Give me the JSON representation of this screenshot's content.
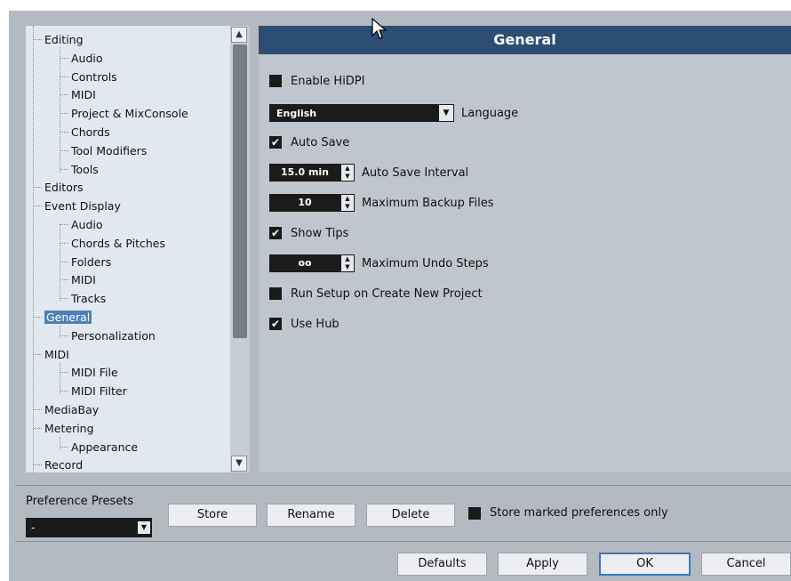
{
  "tree": {
    "items": [
      {
        "label": "Editing",
        "level": 0
      },
      {
        "label": "Audio",
        "level": 1
      },
      {
        "label": "Controls",
        "level": 1
      },
      {
        "label": "MIDI",
        "level": 1
      },
      {
        "label": "Project & MixConsole",
        "level": 1
      },
      {
        "label": "Chords",
        "level": 1
      },
      {
        "label": "Tool Modifiers",
        "level": 1
      },
      {
        "label": "Tools",
        "level": 1
      },
      {
        "label": "Editors",
        "level": 0
      },
      {
        "label": "Event Display",
        "level": 0
      },
      {
        "label": "Audio",
        "level": 1
      },
      {
        "label": "Chords & Pitches",
        "level": 1
      },
      {
        "label": "Folders",
        "level": 1
      },
      {
        "label": "MIDI",
        "level": 1
      },
      {
        "label": "Tracks",
        "level": 1
      },
      {
        "label": "General",
        "level": 0,
        "selected": true
      },
      {
        "label": "Personalization",
        "level": 1
      },
      {
        "label": "MIDI",
        "level": 0
      },
      {
        "label": "MIDI File",
        "level": 1
      },
      {
        "label": "MIDI Filter",
        "level": 1
      },
      {
        "label": "MediaBay",
        "level": 0
      },
      {
        "label": "Metering",
        "level": 0
      },
      {
        "label": "Appearance",
        "level": 1
      },
      {
        "label": "Record",
        "level": 0
      }
    ],
    "scroll_up_icon": "chevron-up-icon",
    "scroll_down_icon": "chevron-down-icon"
  },
  "panel": {
    "title": "General",
    "enable_hidpi": {
      "label": "Enable HiDPI",
      "checked": false
    },
    "language": {
      "value": "English",
      "label": "Language"
    },
    "auto_save": {
      "label": "Auto Save",
      "checked": true
    },
    "auto_save_interval": {
      "value": "15.0 min",
      "label": "Auto Save Interval"
    },
    "max_backup_files": {
      "value": "10",
      "label": "Maximum Backup Files"
    },
    "show_tips": {
      "label": "Show Tips",
      "checked": true
    },
    "max_undo_steps": {
      "value": "oo",
      "label": "Maximum Undo Steps"
    },
    "run_setup": {
      "label": "Run Setup on Create New Project",
      "checked": false
    },
    "use_hub": {
      "label": "Use Hub",
      "checked": true
    }
  },
  "bottom": {
    "presets_label": "Preference Presets",
    "presets_value": "-",
    "store": "Store",
    "rename": "Rename",
    "delete": "Delete",
    "store_marked_only": {
      "label": "Store marked preferences only",
      "checked": false
    },
    "defaults": "Defaults",
    "apply": "Apply",
    "ok": "OK",
    "cancel": "Cancel"
  },
  "colors": {
    "header_bg": "#2c4e73",
    "selection": "#4e7fb8",
    "ok_border": "#3a78c6"
  }
}
